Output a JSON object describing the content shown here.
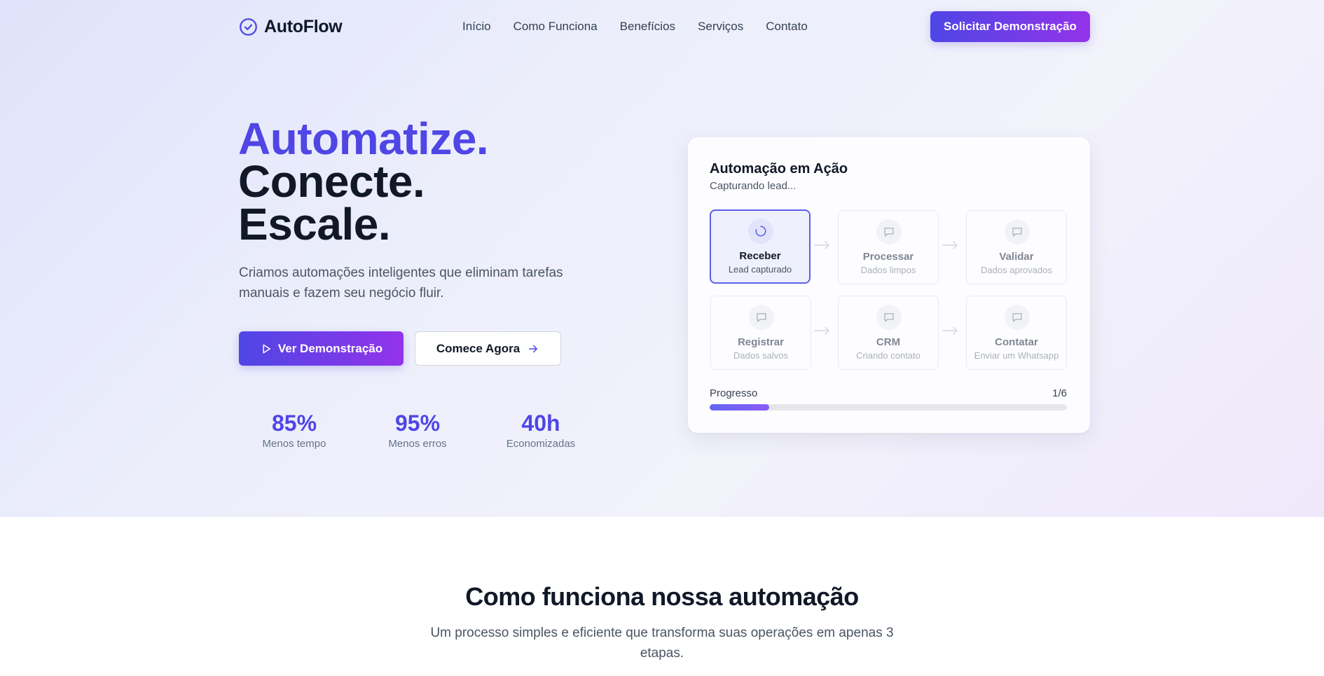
{
  "nav": {
    "brand": "AutoFlow",
    "links": [
      "Início",
      "Como Funciona",
      "Benefícios",
      "Serviços",
      "Contato"
    ],
    "cta": "Solicitar Demonstração"
  },
  "hero": {
    "headline": [
      "Automatize.",
      "Conecte.",
      "Escale."
    ],
    "subtitle": "Criamos automações inteligentes que eliminam tarefas manuais e fazem seu negócio fluir.",
    "primary_button": "Ver Demonstração",
    "secondary_button": "Comece Agora",
    "stats": [
      {
        "value": "85%",
        "label": "Menos tempo"
      },
      {
        "value": "95%",
        "label": "Menos erros"
      },
      {
        "value": "40h",
        "label": "Economizadas"
      }
    ]
  },
  "demo_card": {
    "title": "Automação em Ação",
    "status": "Capturando lead...",
    "steps": [
      {
        "name": "Receber",
        "desc": "Lead capturado",
        "icon": "loader-icon",
        "active": true
      },
      {
        "name": "Processar",
        "desc": "Dados limpos",
        "icon": "message-icon",
        "active": false
      },
      {
        "name": "Validar",
        "desc": "Dados aprovados",
        "icon": "message-icon",
        "active": false
      },
      {
        "name": "Registrar",
        "desc": "Dados salvos",
        "icon": "message-icon",
        "active": false
      },
      {
        "name": "CRM",
        "desc": "Criando contato",
        "icon": "message-icon",
        "active": false
      },
      {
        "name": "Contatar",
        "desc": "Enviar um Whatsapp",
        "icon": "message-icon",
        "active": false
      }
    ],
    "progress_label": "Progresso",
    "progress_count": "1/6",
    "progress_value": 0.167
  },
  "how_it_works": {
    "title": "Como funciona nossa automação",
    "subtitle": "Um processo simples e eficiente que transforma suas operações em apenas 3 etapas."
  },
  "colors": {
    "accent": "#4f46e5",
    "accent_end": "#9333ea",
    "text_dark": "#111827",
    "text_muted": "#4b5563"
  }
}
